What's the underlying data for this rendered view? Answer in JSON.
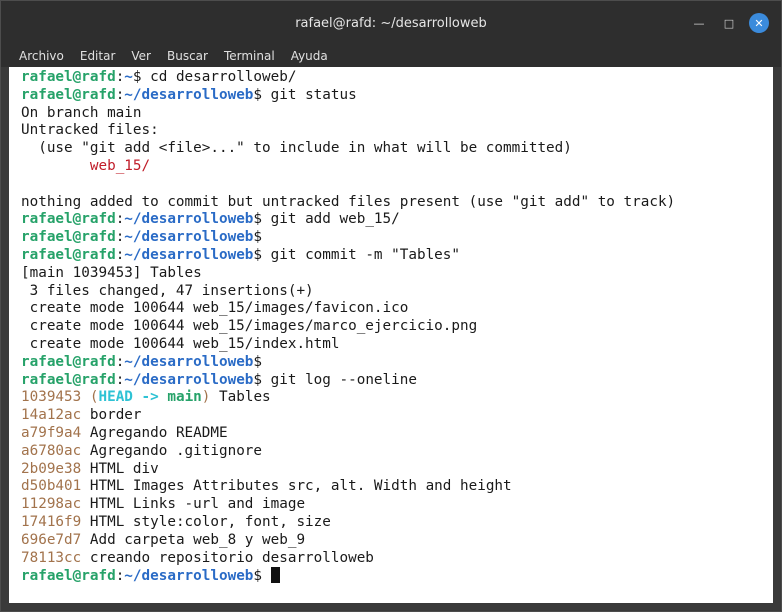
{
  "window": {
    "title": "rafael@rafd: ~/desarrolloweb",
    "controls": [
      "minimize-icon",
      "maximize-icon",
      "close-icon"
    ]
  },
  "menu": [
    "Archivo",
    "Editar",
    "Ver",
    "Buscar",
    "Terminal",
    "Ayuda"
  ],
  "colors": {
    "user": "#26a269",
    "path": "#2a6bc6",
    "untracked": "#c01c28",
    "hash": "#a2734c",
    "head": "#2ec2d4"
  },
  "terminal": {
    "user": "rafael@rafd",
    "lines": [
      {
        "type": "prompt",
        "path": "~",
        "cmd": " cd desarrolloweb/"
      },
      {
        "type": "prompt",
        "path": "~/desarrolloweb",
        "cmd": " git status"
      },
      {
        "type": "text",
        "text": "On branch main"
      },
      {
        "type": "text",
        "text": "Untracked files:"
      },
      {
        "type": "text",
        "text": "  (use \"git add <file>...\" to include in what will be committed)"
      },
      {
        "type": "untracked",
        "text": "web_15/"
      },
      {
        "type": "text",
        "text": ""
      },
      {
        "type": "text",
        "text": "nothing added to commit but untracked files present (use \"git add\" to track)"
      },
      {
        "type": "prompt",
        "path": "~/desarrolloweb",
        "cmd": " git add web_15/"
      },
      {
        "type": "prompt",
        "path": "~/desarrolloweb",
        "cmd": ""
      },
      {
        "type": "prompt",
        "path": "~/desarrolloweb",
        "cmd": " git commit -m \"Tables\""
      },
      {
        "type": "text",
        "text": "[main 1039453] Tables"
      },
      {
        "type": "text",
        "text": " 3 files changed, 47 insertions(+)"
      },
      {
        "type": "text",
        "text": " create mode 100644 web_15/images/favicon.ico"
      },
      {
        "type": "text",
        "text": " create mode 100644 web_15/images/marco_ejercicio.png"
      },
      {
        "type": "text",
        "text": " create mode 100644 web_15/index.html"
      },
      {
        "type": "prompt",
        "path": "~/desarrolloweb",
        "cmd": ""
      },
      {
        "type": "prompt",
        "path": "~/desarrolloweb",
        "cmd": " git log --oneline"
      },
      {
        "type": "loghead",
        "hash": "1039453",
        "head": "HEAD -> ",
        "branch": "main",
        "msg": " Tables"
      },
      {
        "type": "log",
        "hash": "14a12ac",
        "msg": " border"
      },
      {
        "type": "log",
        "hash": "a79f9a4",
        "msg": " Agregando README"
      },
      {
        "type": "log",
        "hash": "a6780ac",
        "msg": " Agregando .gitignore"
      },
      {
        "type": "log",
        "hash": "2b09e38",
        "msg": " HTML div"
      },
      {
        "type": "log",
        "hash": "d50b401",
        "msg": " HTML Images Attributes src, alt. Width and height"
      },
      {
        "type": "log",
        "hash": "11298ac",
        "msg": " HTML Links -url and image"
      },
      {
        "type": "log",
        "hash": "17416f9",
        "msg": " HTML style:color, font, size"
      },
      {
        "type": "log",
        "hash": "696e7d7",
        "msg": " Add carpeta web_8 y web_9"
      },
      {
        "type": "log",
        "hash": "78113cc",
        "msg": " creando repositorio desarrolloweb"
      },
      {
        "type": "prompt",
        "path": "~/desarrolloweb",
        "cmd": " ",
        "cursor": true
      }
    ]
  }
}
